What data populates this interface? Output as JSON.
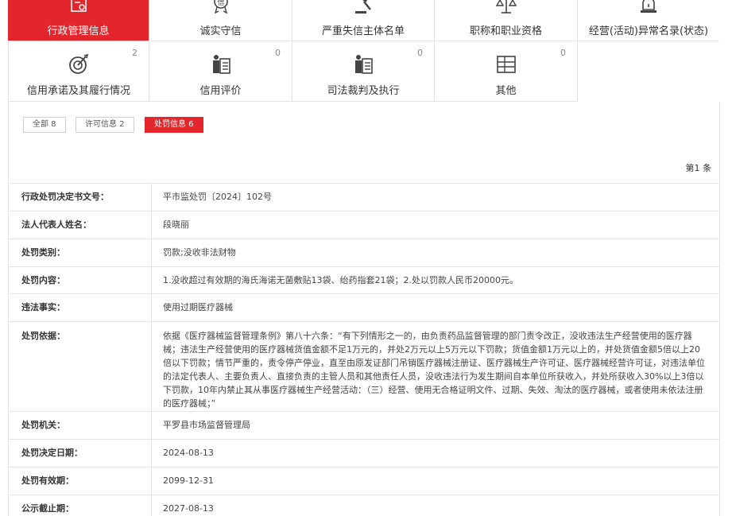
{
  "tabs_row1": [
    {
      "label": "行政管理信息",
      "icon": "admin-doc-icon",
      "active": true
    },
    {
      "label": "诚实守信",
      "icon": "trust-medal-icon",
      "active": false
    },
    {
      "label": "严重失信主体名单",
      "icon": "gavel-icon",
      "active": false
    },
    {
      "label": "职称和职业资格",
      "icon": "scale-icon",
      "active": false
    },
    {
      "label": "经营(活动)异常名录(状态)",
      "icon": "alarm-light-icon",
      "active": false
    }
  ],
  "tabs_row2": [
    {
      "label": "信用承诺及其履行情况",
      "icon": "target-icon",
      "count": "2"
    },
    {
      "label": "信用评价",
      "icon": "rating-badge-icon",
      "count": "0"
    },
    {
      "label": "司法裁判及执行",
      "icon": "judicial-icon",
      "count": "0"
    },
    {
      "label": "其他",
      "icon": "grid-doc-icon",
      "count": "0"
    }
  ],
  "filters": [
    {
      "label": "全部 8",
      "active": false
    },
    {
      "label": "许可信息 2",
      "active": false
    },
    {
      "label": "处罚信息 6",
      "active": true
    }
  ],
  "page_count": "第1 条",
  "detail": {
    "decision_no": {
      "key": "行政处罚决定书文号：",
      "value": "平市监处罚〔2024〕102号"
    },
    "legal_rep": {
      "key": "法人代表人姓名：",
      "value": "段晓丽"
    },
    "penalty_type": {
      "key": "处罚类别：",
      "value": "罚款;没收非法财物"
    },
    "penalty_content": {
      "key": "处罚内容：",
      "value": "1.没收超过有效期的海氏海诺无菌敷贴13袋、绐药指套21袋；2.处以罚款人民币20000元。"
    },
    "violation_fact": {
      "key": "违法事实：",
      "value": "使用过期医疗器械"
    },
    "penalty_basis": {
      "key": "处罚依据：",
      "value": "依据《医疗器械监督管理条例》第八十六条：“有下列情形之一的，由负责药品监督管理的部门责令改正，没收违法生产经营使用的医疗器械；违法生产经营使用的医疗器械货值金额不足1万元的，并处2万元以上5万元以下罚款；货值金额1万元以上的，并处货值金额5倍以上20倍以下罚款；情节严重的，责令停产停业，直至由原发证部门吊销医疗器械注册证、医疗器械生产许可证、医疗器械经营许可证，对违法单位的法定代表人、主要负责人、直接负责的主管人员和其他责任人员，没收违法行为发生期间自本单位所获收入，并处所获收入30%以上3倍以下罚款，10年内禁止其从事医疗器械生产经营活动：（三）经营、使用无合格证明文件、过期、失效、淘汰的医疗器械，或者使用未依法注册的医疗器械；”"
    },
    "authority": {
      "key": "处罚机关：",
      "value": "平罗县市场监督管理局"
    },
    "decision_date": {
      "key": "处罚决定日期：",
      "value": "2024-08-13"
    },
    "valid_until": {
      "key": "处罚有效期：",
      "value": "2099-12-31"
    },
    "publicity_end": {
      "key": "公示截止期：",
      "value": "2027-08-13"
    }
  },
  "colors": {
    "accent": "#e3262c",
    "border": "#e4e4e4"
  }
}
